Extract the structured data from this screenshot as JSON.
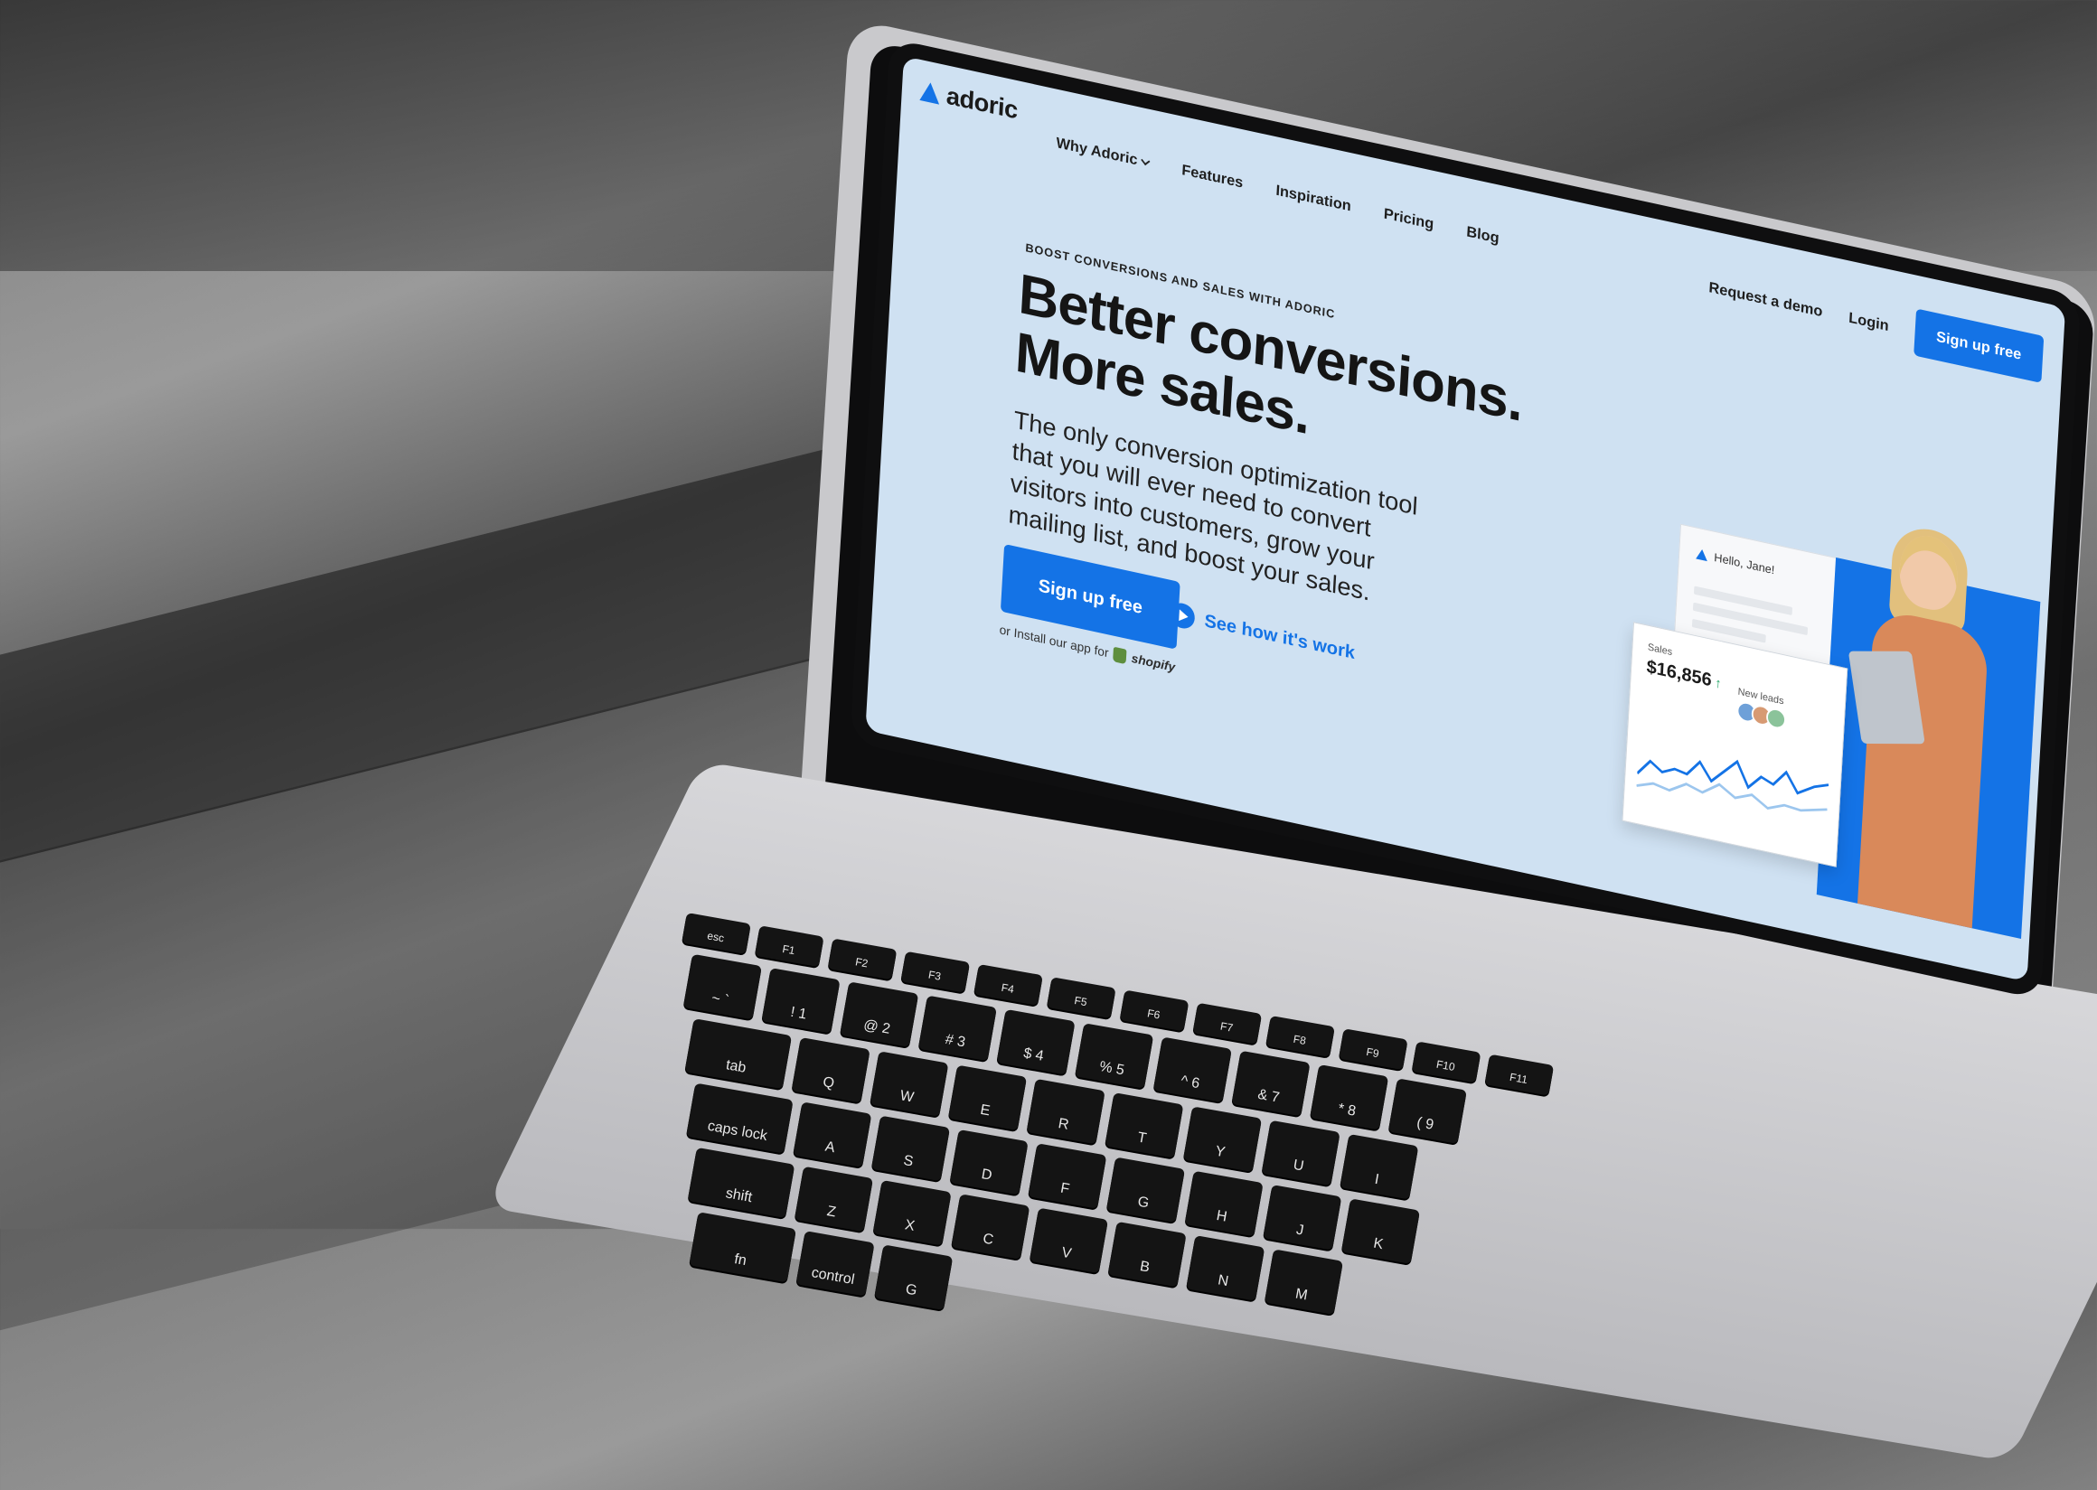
{
  "brand": {
    "name": "adoric",
    "accent": "#1473e6"
  },
  "nav": {
    "items": [
      {
        "label": "Why Adoric",
        "has_dropdown": true
      },
      {
        "label": "Features"
      },
      {
        "label": "Inspiration"
      },
      {
        "label": "Pricing"
      },
      {
        "label": "Blog"
      }
    ]
  },
  "auth": {
    "demo": "Request a demo",
    "login": "Login",
    "signup": "Sign up free"
  },
  "hero": {
    "eyebrow": "BOOST CONVERSIONS AND SALES WITH ADORIC",
    "headline_1": "Better conversions.",
    "headline_2": "More sales.",
    "subtext": "The only conversion optimization tool that you will ever need to convert visitors into customers, grow your mailing list, and boost your sales.",
    "cta": "Sign up free",
    "secondary": "See how it's work",
    "install_prefix": "or Install our app for",
    "install_platform": "shopify"
  },
  "illustration": {
    "greeting": "Hello, Jane!",
    "sales_label": "Sales",
    "sales_value": "$16,856",
    "leads_label": "New leads"
  },
  "keyboard": {
    "rows": [
      [
        "esc",
        "F1",
        "F2",
        "F3",
        "F4",
        "F5",
        "F6",
        "F7",
        "F8",
        "F9",
        "F10",
        "F11"
      ],
      [
        "~ `",
        "! 1",
        "@ 2",
        "# 3",
        "$ 4",
        "% 5",
        "^ 6",
        "& 7",
        "* 8",
        "( 9"
      ],
      [
        "tab",
        "Q",
        "W",
        "E",
        "R",
        "T",
        "Y",
        "U",
        "I"
      ],
      [
        "caps lock",
        "A",
        "S",
        "D",
        "F",
        "G",
        "H",
        "J",
        "K"
      ],
      [
        "shift",
        "Z",
        "X",
        "C",
        "V",
        "B",
        "N",
        "M"
      ],
      [
        "fn",
        "control",
        "G"
      ]
    ]
  }
}
